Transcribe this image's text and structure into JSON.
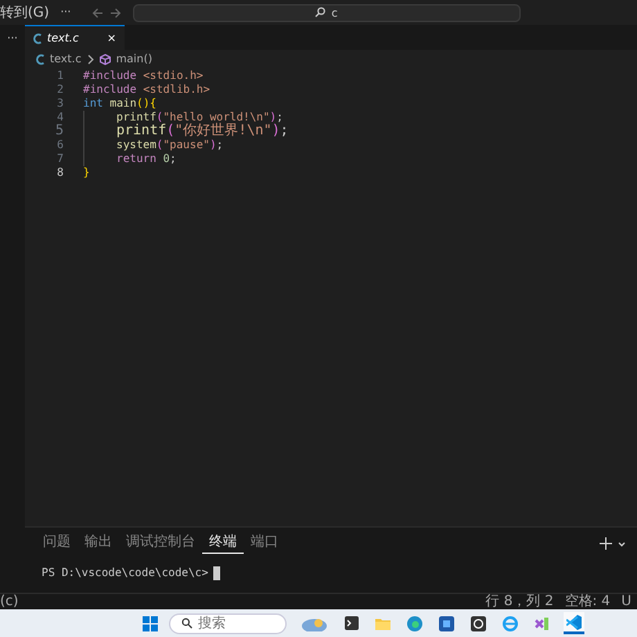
{
  "title_bar": {
    "menu": "转到(G)",
    "more": "···",
    "search": "c"
  },
  "sidebar": {
    "more": "···"
  },
  "editor_tabs": [
    {
      "label": "text.c",
      "close": "×",
      "selected": true
    }
  ],
  "breadcrumb": [
    "text.c",
    "main()"
  ],
  "code": [
    {
      "number": "1",
      "current": false,
      "guide": false,
      "tokens": [
        {
          "kind": "dir",
          "text": "#include "
        },
        {
          "kind": "str",
          "text": "<stdio.h>"
        }
      ]
    },
    {
      "number": "2",
      "current": false,
      "guide": false,
      "tokens": [
        {
          "kind": "dir",
          "text": "#include "
        },
        {
          "kind": "str",
          "text": "<stdlib.h>"
        }
      ]
    },
    {
      "number": "3",
      "current": false,
      "guide": false,
      "tokens": [
        {
          "kind": "kw",
          "text": "int "
        },
        {
          "kind": "fn",
          "text": "main"
        },
        {
          "kind": "br",
          "text": "(){"
        }
      ]
    },
    {
      "number": "4",
      "current": false,
      "guide": true,
      "tokens": [
        {
          "kind": "fn",
          "text": "printf"
        },
        {
          "kind": "br2",
          "text": "("
        },
        {
          "kind": "str",
          "text": "\"hello world!\\n\""
        },
        {
          "kind": "br2",
          "text": ")"
        },
        {
          "kind": "plain",
          "text": ";"
        }
      ]
    },
    {
      "number": "5",
      "current": false,
      "guide": true,
      "tokens": [
        {
          "kind": "fn",
          "text": "printf"
        },
        {
          "kind": "br2",
          "text": "("
        },
        {
          "kind": "str",
          "text": "\"你好世界!\\n\""
        },
        {
          "kind": "br2",
          "text": ")"
        },
        {
          "kind": "plain",
          "text": ";"
        }
      ]
    },
    {
      "number": "6",
      "current": false,
      "guide": true,
      "tokens": [
        {
          "kind": "fn",
          "text": "system"
        },
        {
          "kind": "br2",
          "text": "("
        },
        {
          "kind": "str",
          "text": "\"pause\""
        },
        {
          "kind": "br2",
          "text": ")"
        },
        {
          "kind": "plain",
          "text": ";"
        }
      ]
    },
    {
      "number": "7",
      "current": false,
      "guide": true,
      "tokens": [
        {
          "kind": "ctl",
          "text": "return "
        },
        {
          "kind": "num",
          "text": "0"
        },
        {
          "kind": "plain",
          "text": ";"
        }
      ]
    },
    {
      "number": "8",
      "current": true,
      "guide": false,
      "tokens": [
        {
          "kind": "br",
          "text": "}"
        }
      ]
    }
  ],
  "panel_tabs": [
    {
      "label": "问题",
      "selected": false
    },
    {
      "label": "输出",
      "selected": false
    },
    {
      "label": "调试控制台",
      "selected": false
    },
    {
      "label": "终端",
      "selected": true
    },
    {
      "label": "端口",
      "selected": false
    }
  ],
  "terminal": {
    "prompt": "PS D:\\vscode\\code\\code\\c>"
  },
  "status_bar": {
    "left": "(c)",
    "right": [
      "行 8，列 2",
      "空格: 4",
      "U"
    ]
  },
  "taskbar": {
    "search": {
      "placeholder": "搜索"
    },
    "apps": [
      {
        "kind": "widget",
        "active": false
      },
      {
        "kind": "terminal",
        "active": false
      },
      {
        "kind": "folder",
        "active": false
      },
      {
        "kind": "browser",
        "active": false
      },
      {
        "kind": "store",
        "active": false
      },
      {
        "kind": "camera",
        "active": false
      },
      {
        "kind": "ie",
        "active": false
      },
      {
        "kind": "vs",
        "active": false
      },
      {
        "kind": "vscode",
        "active": true
      }
    ]
  }
}
